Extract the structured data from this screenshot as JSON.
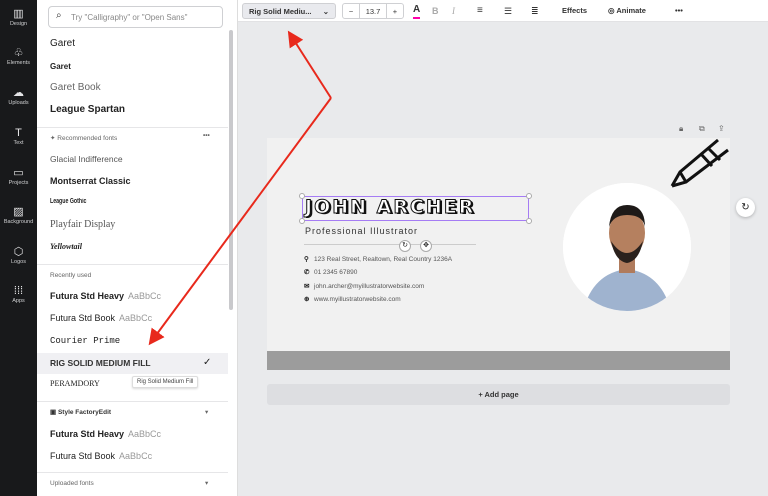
{
  "nav": [
    {
      "label": "Design",
      "icon": "layout-icon"
    },
    {
      "label": "Elements",
      "icon": "shapes-icon"
    },
    {
      "label": "Uploads",
      "icon": "cloud-upload-icon"
    },
    {
      "label": "Text",
      "icon": "text-icon"
    },
    {
      "label": "Projects",
      "icon": "folder-icon"
    },
    {
      "label": "Background",
      "icon": "pattern-icon"
    },
    {
      "label": "Logos",
      "icon": "logo-icon"
    },
    {
      "label": "Apps",
      "icon": "grid-icon"
    }
  ],
  "panel": {
    "search_placeholder": "Try \"Calligraphy\" or \"Open Sans\"",
    "top_fonts": [
      "Garet",
      "Garet",
      "Garet Book",
      "League Spartan"
    ],
    "recommended_header": "Recommended fonts",
    "recommended": [
      "Glacial Indifference",
      "Montserrat Classic",
      "League Gothic",
      "Playfair Display",
      "Yellowtail"
    ],
    "recent_header": "Recently used",
    "recent": [
      "Futura Std Heavy",
      "Futura Std Book",
      "Courier Prime",
      "RIG SOLID MEDIUM FILL",
      "PERAMDORY"
    ],
    "sample": "AaBbCc",
    "tooltip": "Rig Solid Medium Fill",
    "kit_header": "Style FactoryEdit",
    "kit": [
      "Futura Std Heavy",
      "Futura Std Book"
    ],
    "uploaded_header": "Uploaded fonts"
  },
  "toolbar": {
    "font": "Rig Solid Mediu...",
    "minus": "−",
    "size": "13.7",
    "plus": "+",
    "bold": "B",
    "italic": "I",
    "effects": "Effects",
    "animate": "Animate",
    "more": "•••"
  },
  "card": {
    "name": "JOHN ARCHER",
    "title": "Professional Illustrator",
    "address": "123 Real Street, Realtown, Real Country 1236A",
    "phone": "01 2345 67890",
    "email": "john.archer@myillustratorwebsite.com",
    "website": "www.myillustratorwebsite.com"
  },
  "add_page": "+ Add page",
  "colors": {
    "accent": "#a57cf4",
    "arrow": "#e8291c",
    "nav_bg": "#18191b"
  }
}
